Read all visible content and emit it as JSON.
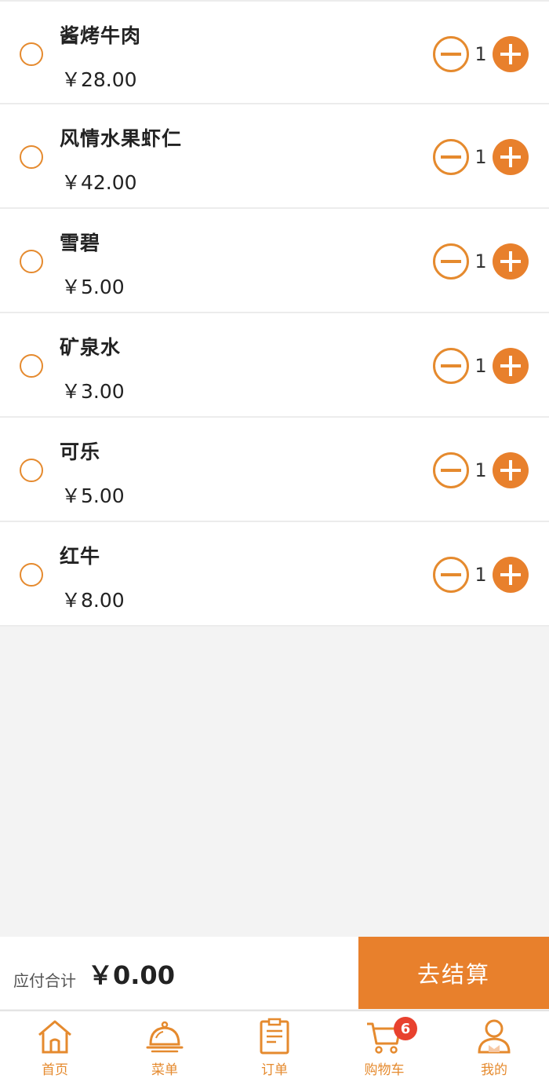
{
  "cart": {
    "items": [
      {
        "name": "酱烤牛肉",
        "price": "￥28.00",
        "qty": "1"
      },
      {
        "name": "风情水果虾仁",
        "price": "￥42.00",
        "qty": "1"
      },
      {
        "name": "雪碧",
        "price": "￥5.00",
        "qty": "1"
      },
      {
        "name": "矿泉水",
        "price": "￥3.00",
        "qty": "1"
      },
      {
        "name": "可乐",
        "price": "￥5.00",
        "qty": "1"
      },
      {
        "name": "红牛",
        "price": "￥8.00",
        "qty": "1"
      }
    ]
  },
  "checkout": {
    "total_label": "应付合计",
    "total_value": "￥0.00",
    "pay_label": "去结算"
  },
  "tabbar": {
    "tabs": [
      {
        "label": "首页",
        "icon": "home-icon"
      },
      {
        "label": "菜单",
        "icon": "food-cloche-icon"
      },
      {
        "label": "订单",
        "icon": "clipboard-icon"
      },
      {
        "label": "购物车",
        "icon": "cart-icon",
        "badge": "6"
      },
      {
        "label": "我的",
        "icon": "user-icon"
      }
    ]
  },
  "colors": {
    "accent": "#e8802c",
    "badge": "#e8412e",
    "background": "#f3f3f3"
  }
}
